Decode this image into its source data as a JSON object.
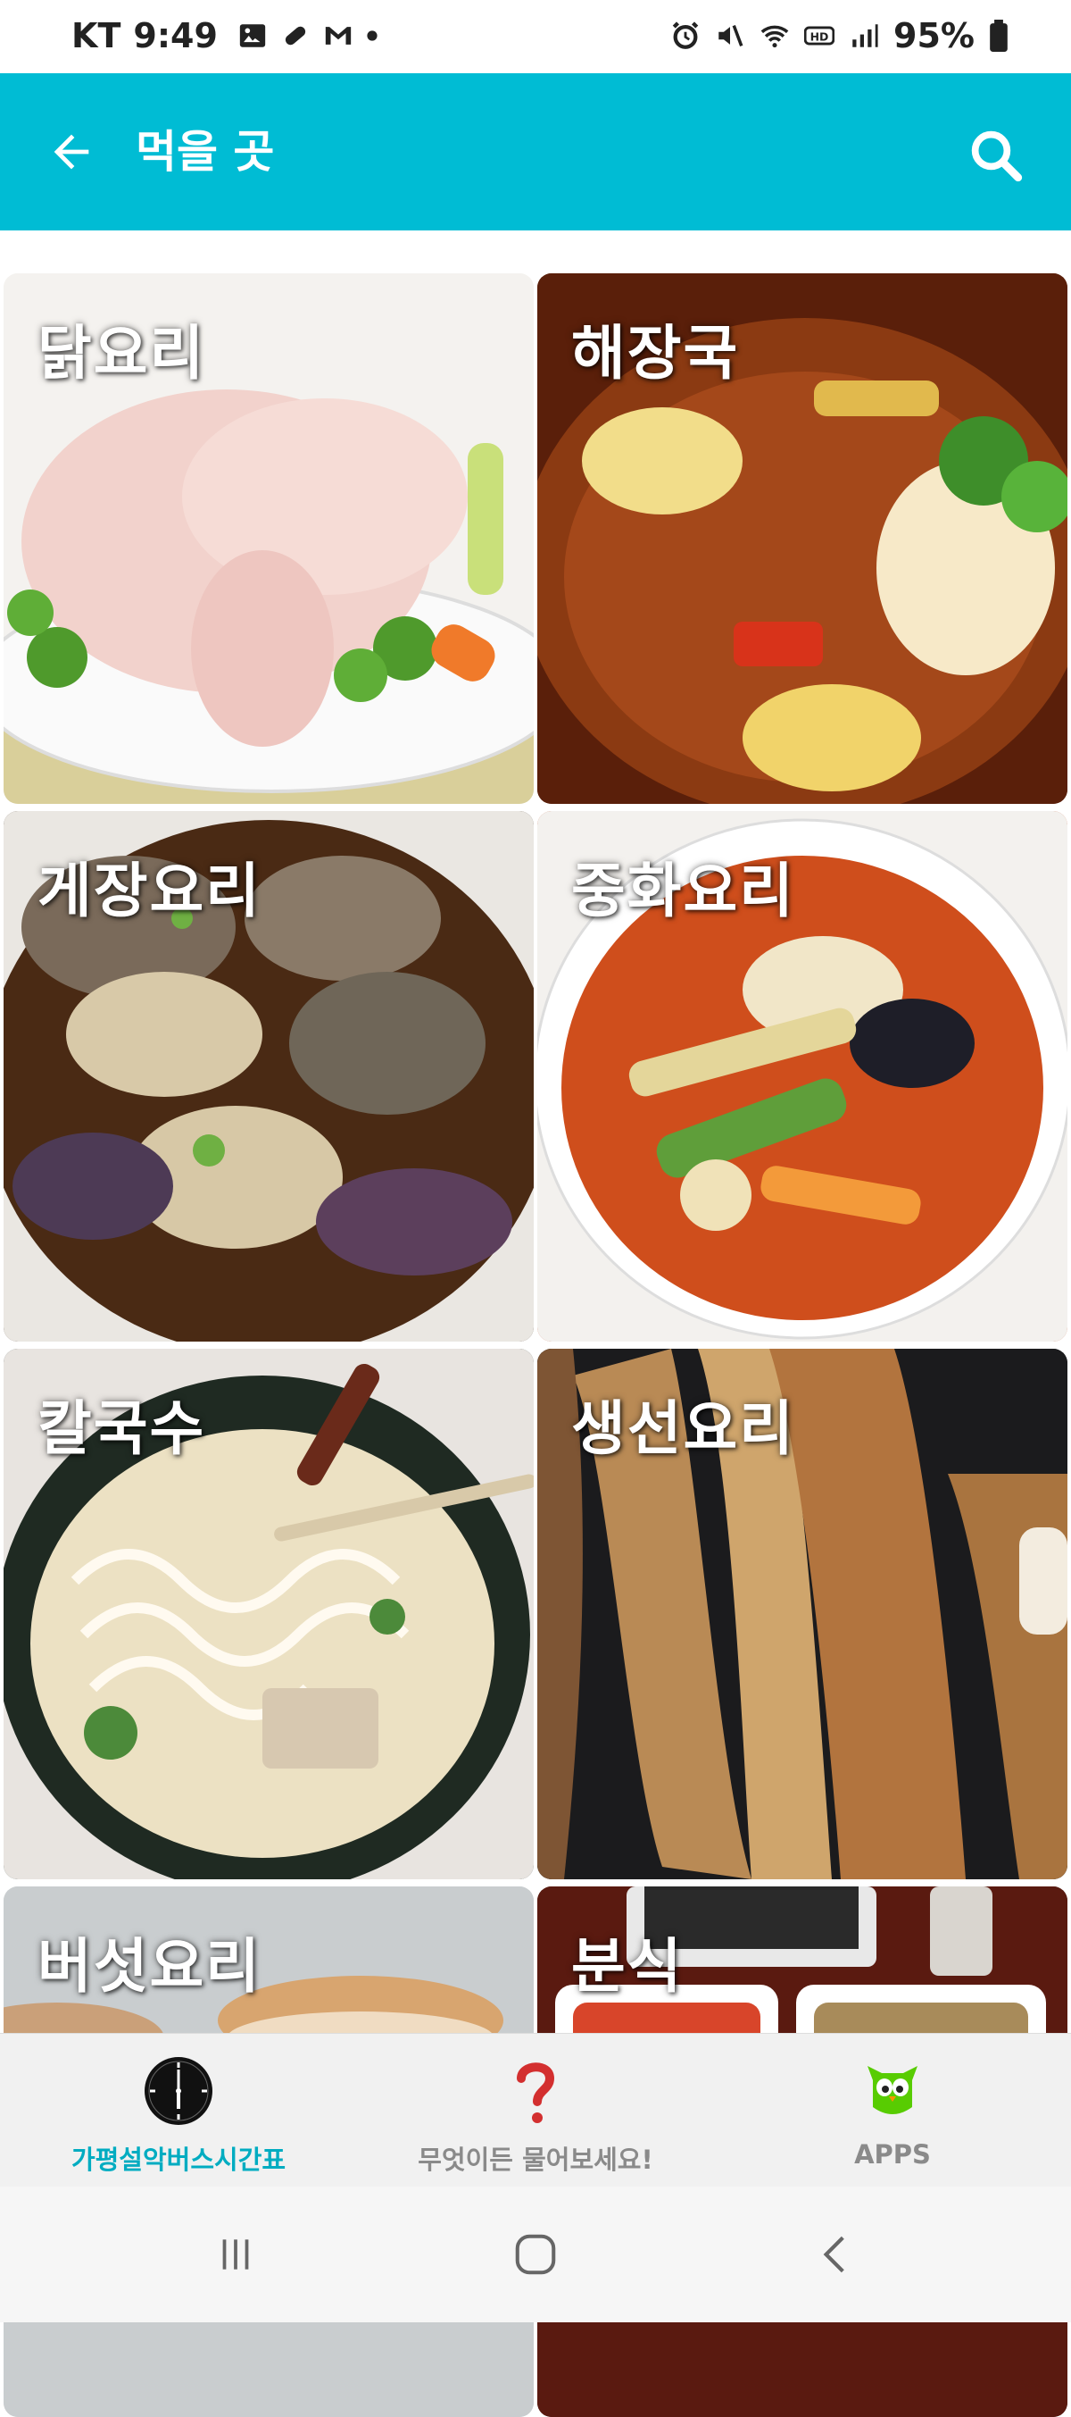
{
  "status_bar": {
    "carrier": "KT",
    "time": "9:49",
    "battery": "95%"
  },
  "app_bar": {
    "title": "먹을 곳",
    "back_icon": "arrow-left-icon",
    "search_icon": "search-icon"
  },
  "categories": [
    {
      "label": "닭요리"
    },
    {
      "label": "해장국"
    },
    {
      "label": "게장요리"
    },
    {
      "label": "중화요리"
    },
    {
      "label": "칼국수"
    },
    {
      "label": "생선요리"
    },
    {
      "label": "버섯요리"
    },
    {
      "label": "분식"
    }
  ],
  "bottom_nav": [
    {
      "label": "가평설악버스시간표",
      "icon": "clock-icon",
      "active": true
    },
    {
      "label": "무엇이든 물어보세요!",
      "icon": "question-mark-icon",
      "active": false
    },
    {
      "label": "APPS",
      "icon": "owl-mascot-icon",
      "active": false
    }
  ],
  "colors": {
    "primary": "#00bcd4",
    "active_label": "#00acc1",
    "inactive_label": "#8a8a8a",
    "question_mark": "#d32f2f",
    "owl": "#58cc02"
  }
}
